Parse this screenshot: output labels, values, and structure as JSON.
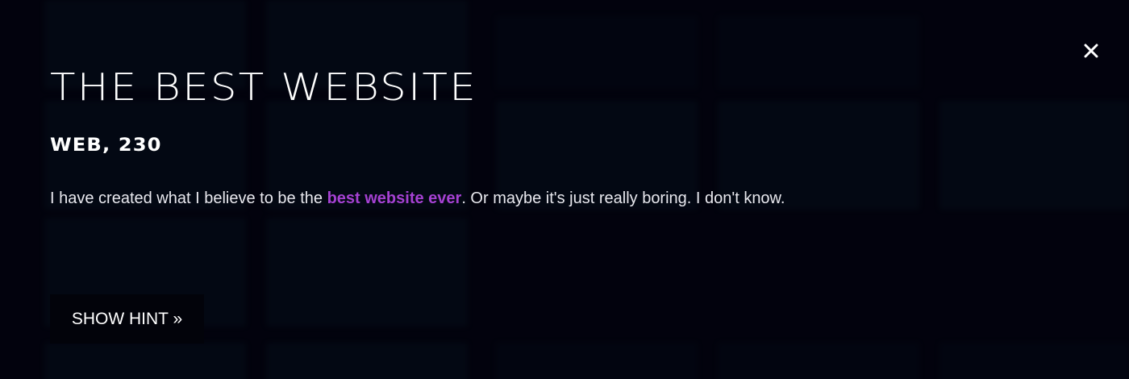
{
  "modal": {
    "title": "THE BEST WEBSITE",
    "category_points": "WEB, 230",
    "description": {
      "before_link": "I have created what I believe to be the ",
      "link_text": "best website ever",
      "after_link": ". Or maybe it's just really boring. I don't know."
    },
    "hint_button_label": "SHOW HINT »",
    "close_icon": "close-icon"
  },
  "colors": {
    "background": "#04070f",
    "text": "#ffffff",
    "link": "#a541d2",
    "button_bg": "#02030a"
  }
}
